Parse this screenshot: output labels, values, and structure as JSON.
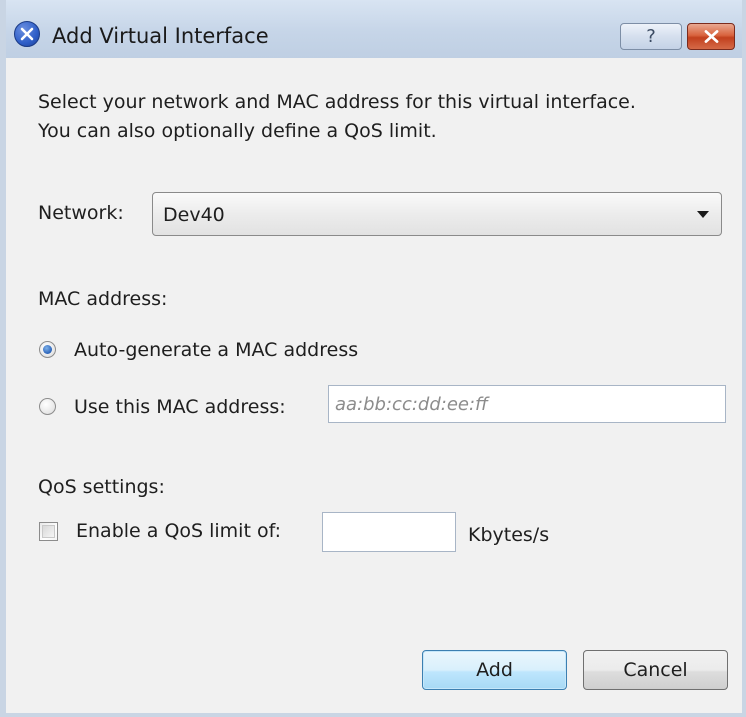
{
  "window": {
    "title": "Add Virtual Interface",
    "help_label": "?",
    "icons": {
      "app": "x-logo-icon",
      "close": "close-icon"
    },
    "colors": {
      "titlebar": "#c6d5e8",
      "close_button": "#c2401e",
      "dialog_background": "#f1f1f1"
    }
  },
  "intro": {
    "line1": "Select your network and MAC address for this virtual interface.",
    "line2": "You can also optionally define a QoS limit."
  },
  "network": {
    "label": "Network:",
    "selected": "Dev40"
  },
  "mac": {
    "section_label": "MAC address:",
    "auto_label": "Auto-generate a MAC address",
    "auto_selected": true,
    "manual_label": "Use this MAC address:",
    "manual_selected": false,
    "manual_value": "",
    "manual_placeholder": "aa:bb:cc:dd:ee:ff"
  },
  "qos": {
    "section_label": "QoS settings:",
    "enable_label": "Enable a QoS limit of:",
    "enabled": false,
    "limit_value": "",
    "unit": "Kbytes/s"
  },
  "buttons": {
    "add": "Add",
    "cancel": "Cancel"
  }
}
